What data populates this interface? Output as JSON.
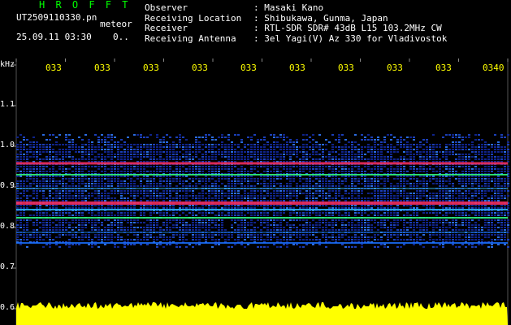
{
  "header": {
    "app_title": "H R O F F T",
    "file_name": "UT2509110330.pn",
    "meteor_label": "meteor",
    "timestamp": "25.09.11 03:30",
    "meteor_count": "0.."
  },
  "station": {
    "labels": [
      "Observer",
      "Receiving Location",
      "Receiver",
      "Receiving Antenna"
    ],
    "values": [
      ": Masaki Kano",
      ": Shibukawa, Gunma, Japan",
      ": RTL-SDR SDR# 43dB L15 103.2MHz CW",
      ": 3el Yagi(V) Az 330 for Vladivostok"
    ]
  },
  "axes": {
    "y_unit": "kHz",
    "y_ticks": [
      "1.1",
      "1.0",
      "0.9",
      "0.8",
      "0.7",
      "0.6"
    ],
    "x_ticks": [
      "033",
      "033",
      "033",
      "033",
      "033",
      "033",
      "033",
      "033",
      "033",
      "0340"
    ]
  },
  "colors": {
    "title": "#00ff00",
    "text": "#ffffff",
    "time_ticks": "#ffff00",
    "noise_floor": "#ffff00",
    "background": "#000000",
    "signal_strong": "#ff3060",
    "signal_mid": "#30ff80",
    "signal_low": "#1030b0"
  }
}
